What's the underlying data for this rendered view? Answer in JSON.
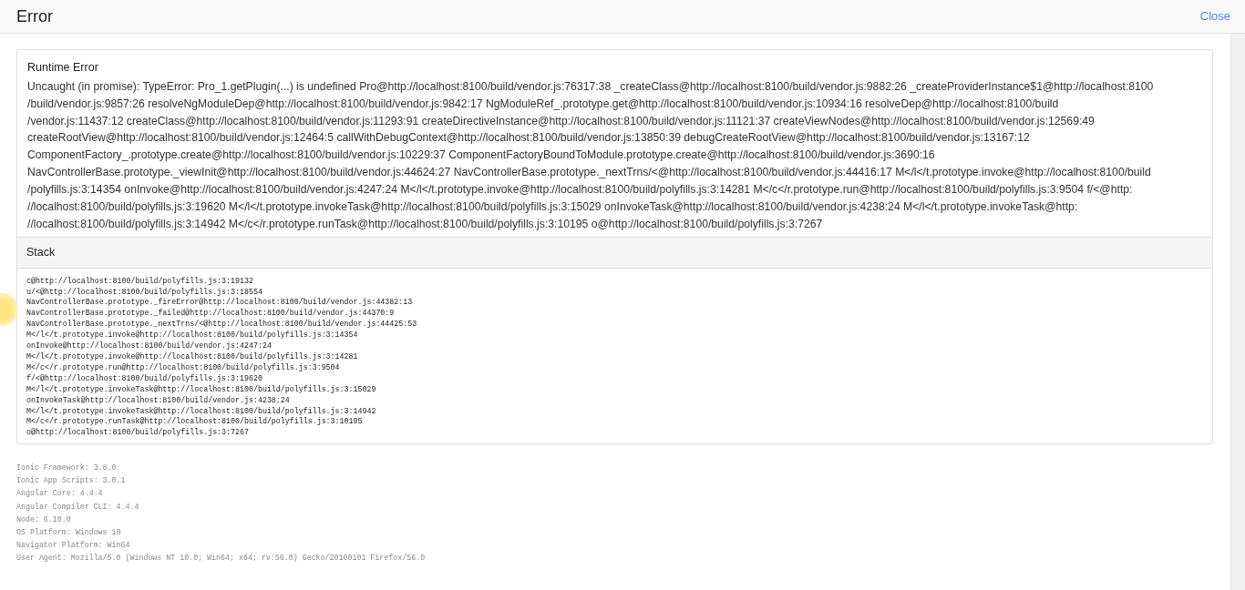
{
  "header": {
    "title": "Error",
    "close_label": "Close"
  },
  "error": {
    "title": "Runtime Error",
    "message_lines": [
      "Uncaught (in promise): TypeError: Pro_1.getPlugin(...) is undefined Pro@http://localhost:8100/build/vendor.js:76317:38 _createClass@http://localhost:8100/build/vendor.js:9882:26 _createProviderInstance$1@http://localhost:8100",
      "/build/vendor.js:9857:26 resolveNgModuleDep@http://localhost:8100/build/vendor.js:9842:17 NgModuleRef_.prototype.get@http://localhost:8100/build/vendor.js:10934:16 resolveDep@http://localhost:8100/build",
      "/vendor.js:11437:12 createClass@http://localhost:8100/build/vendor.js:11293:91 createDirectiveInstance@http://localhost:8100/build/vendor.js:11121:37 createViewNodes@http://localhost:8100/build/vendor.js:12569:49",
      "createRootView@http://localhost:8100/build/vendor.js:12464:5 callWithDebugContext@http://localhost:8100/build/vendor.js:13850:39 debugCreateRootView@http://localhost:8100/build/vendor.js:13167:12",
      "ComponentFactory_.prototype.create@http://localhost:8100/build/vendor.js:10229:37 ComponentFactoryBoundToModule.prototype.create@http://localhost:8100/build/vendor.js:3690:16",
      "NavControllerBase.prototype._viewInit@http://localhost:8100/build/vendor.js:44624:27 NavControllerBase.prototype._nextTrns/<@http://localhost:8100/build/vendor.js:44416:17 M</l</t.prototype.invoke@http://localhost:8100/build",
      "/polyfills.js:3:14354 onInvoke@http://localhost:8100/build/vendor.js:4247:24 M</l</t.prototype.invoke@http://localhost:8100/build/polyfills.js:3:14281 M</c</r.prototype.run@http://localhost:8100/build/polyfills.js:3:9504 f/<@http:",
      "//localhost:8100/build/polyfills.js:3:19620 M</l</t.prototype.invokeTask@http://localhost:8100/build/polyfills.js:3:15029 onInvokeTask@http://localhost:8100/build/vendor.js:4238:24 M</l</t.prototype.invokeTask@http:",
      "//localhost:8100/build/polyfills.js:3:14942 M</c</r.prototype.runTask@http://localhost:8100/build/polyfills.js:3:10195 o@http://localhost:8100/build/polyfills.js:3:7267"
    ],
    "stack_title": "Stack",
    "stack_lines": [
      "c@http://localhost:8100/build/polyfills.js:3:19132",
      "u/<@http://localhost:8100/build/polyfills.js:3:18554",
      "NavControllerBase.prototype._fireError@http://localhost:8100/build/vendor.js:44382:13",
      "NavControllerBase.prototype._failed@http://localhost:8100/build/vendor.js:44370:9",
      "NavControllerBase.prototype._nextTrns/<@http://localhost:8100/build/vendor.js:44425:53",
      "M</l</t.prototype.invoke@http://localhost:8100/build/polyfills.js:3:14354",
      "onInvoke@http://localhost:8100/build/vendor.js:4247:24",
      "M</l</t.prototype.invoke@http://localhost:8100/build/polyfills.js:3:14281",
      "M</c</r.prototype.run@http://localhost:8100/build/polyfills.js:3:9504",
      "f/<@http://localhost:8100/build/polyfills.js:3:19620",
      "M</l</t.prototype.invokeTask@http://localhost:8100/build/polyfills.js:3:15029",
      "onInvokeTask@http://localhost:8100/build/vendor.js:4238:24",
      "M</l</t.prototype.invokeTask@http://localhost:8100/build/polyfills.js:3:14942",
      "M</c</r.prototype.runTask@http://localhost:8100/build/polyfills.js:3:10195",
      "o@http://localhost:8100/build/polyfills.js:3:7267"
    ]
  },
  "environment": [
    "Ionic Framework: 3.8.0",
    "Ionic App Scripts: 3.0.1",
    "Angular Core: 4.4.4",
    "Angular Compiler CLI: 4.4.4",
    "Node: 6.10.0",
    "OS Platform: Windows 10",
    "Navigator Platform: Win64",
    "User Agent: Mozilla/5.0 (Windows NT 10.0; Win64; x64; rv:56.0) Gecko/20100101 Firefox/56.0"
  ]
}
